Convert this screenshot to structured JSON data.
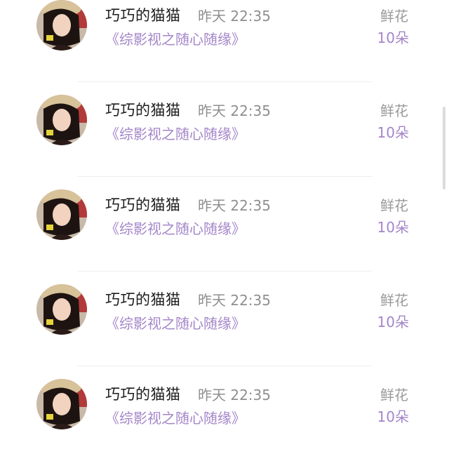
{
  "rows": [
    {
      "user_name": "巧巧的猫猫",
      "time": "昨天 22:35",
      "source": "《综影视之随心随缘》",
      "gift_label": "鲜花",
      "gift_count": "10朵",
      "avatar_icon": "user-avatar-photo"
    },
    {
      "user_name": "巧巧的猫猫",
      "time": "昨天 22:35",
      "source": "《综影视之随心随缘》",
      "gift_label": "鲜花",
      "gift_count": "10朵",
      "avatar_icon": "user-avatar-photo"
    },
    {
      "user_name": "巧巧的猫猫",
      "time": "昨天 22:35",
      "source": "《综影视之随心随缘》",
      "gift_label": "鲜花",
      "gift_count": "10朵",
      "avatar_icon": "user-avatar-photo"
    },
    {
      "user_name": "巧巧的猫猫",
      "time": "昨天 22:35",
      "source": "《综影视之随心随缘》",
      "gift_label": "鲜花",
      "gift_count": "10朵",
      "avatar_icon": "user-avatar-photo"
    },
    {
      "user_name": "巧巧的猫猫",
      "time": "昨天 22:35",
      "source": "《综影视之随心随缘》",
      "gift_label": "鲜花",
      "gift_count": "10朵",
      "avatar_icon": "user-avatar-photo"
    }
  ],
  "colors": {
    "name": "#1c1c1c",
    "time": "#8f8f8f",
    "accent_purple": "#a486c9",
    "gift_label": "#9a9a9a",
    "background": "#ffffff"
  }
}
